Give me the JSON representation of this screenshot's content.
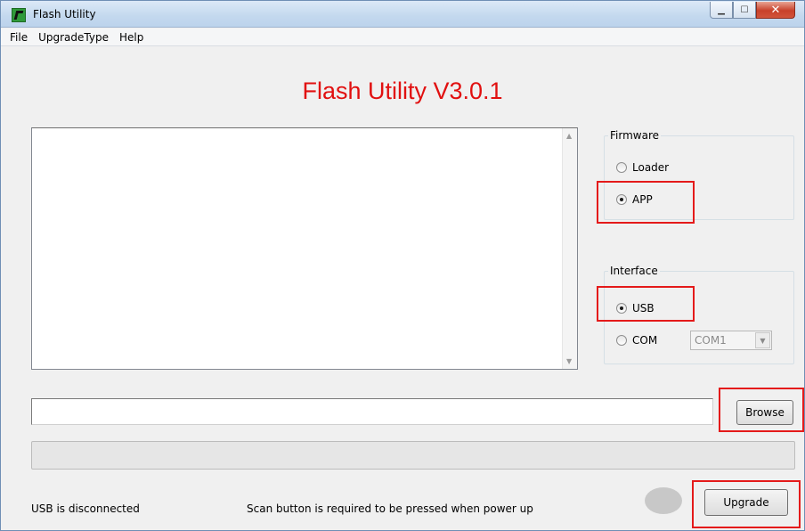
{
  "window": {
    "title": "Flash Utility"
  },
  "menubar": {
    "items": [
      "File",
      "UpgradeType",
      "Help"
    ]
  },
  "app_title": "Flash Utility V3.0.1",
  "firmware": {
    "legend": "Firmware",
    "options": [
      {
        "label": "Loader",
        "checked": false
      },
      {
        "label": "APP",
        "checked": true
      }
    ]
  },
  "interface": {
    "legend": "Interface",
    "options": [
      {
        "label": "USB",
        "checked": true
      },
      {
        "label": "COM",
        "checked": false
      }
    ],
    "com_port": "COM1"
  },
  "path_input": {
    "value": ""
  },
  "buttons": {
    "browse": "Browse",
    "upgrade": "Upgrade"
  },
  "status": {
    "connection": "USB is disconnected",
    "hint": "Scan button is required to be pressed when power up"
  },
  "highlight_color": "#e41a1a",
  "title_color": "#e11010"
}
